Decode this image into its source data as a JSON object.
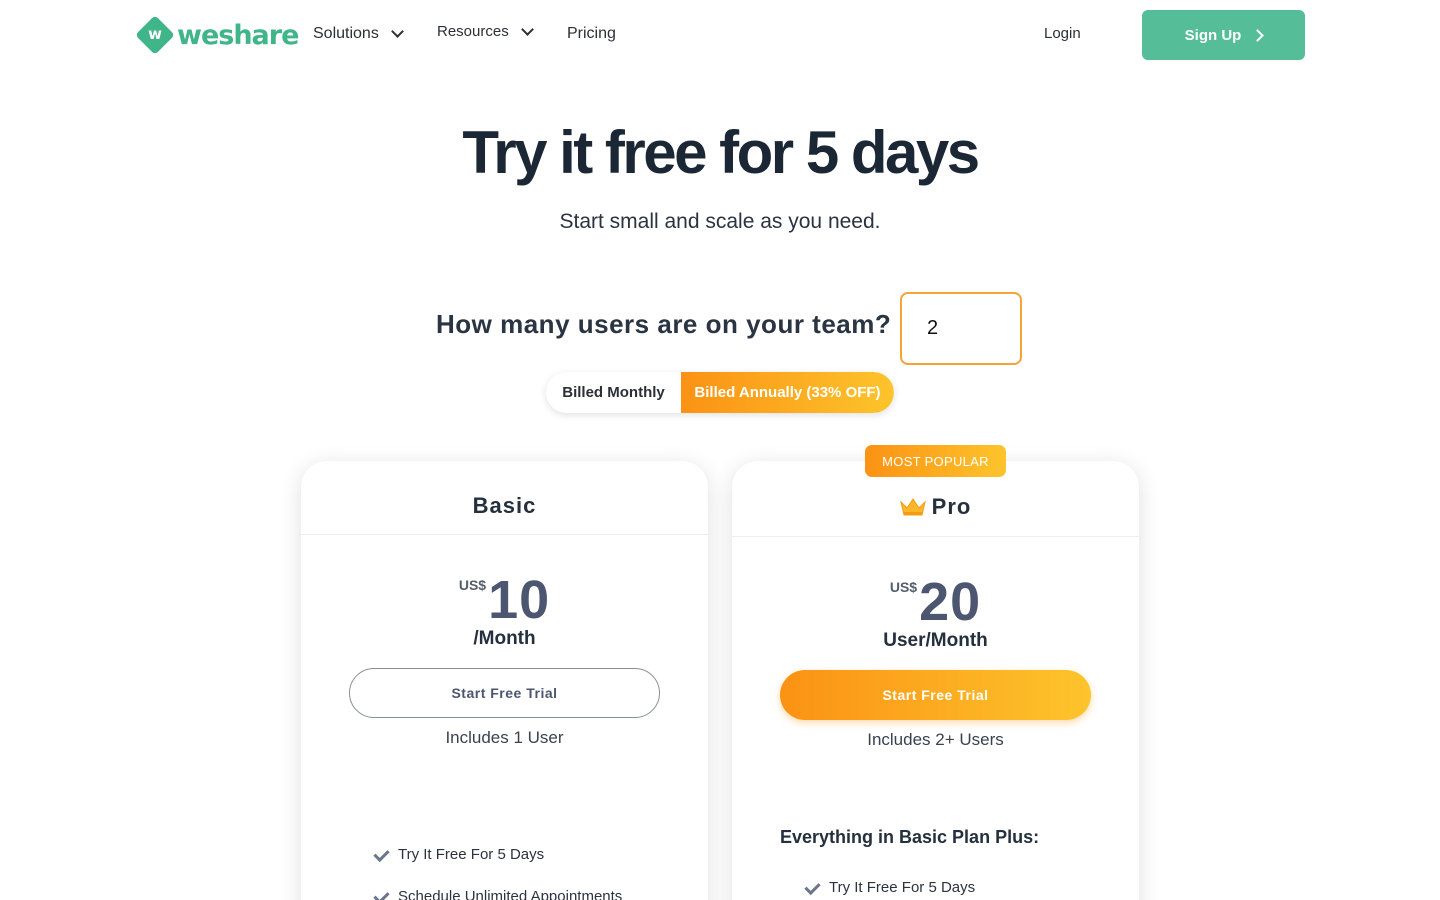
{
  "brand": {
    "name": "weshare",
    "mark_letter": "w",
    "color": "#3fb589"
  },
  "nav": {
    "items": [
      {
        "label": "Solutions",
        "has_dropdown": true
      },
      {
        "label": "Resources",
        "has_dropdown": true
      },
      {
        "label": "Pricing",
        "has_dropdown": false
      }
    ],
    "login": "Login",
    "signup": "Sign Up"
  },
  "hero": {
    "title": "Try it free for 5 days",
    "subtitle": "Start small and scale as you need."
  },
  "team": {
    "question": "How many users are on your team?",
    "value": "2"
  },
  "billing": {
    "monthly": "Billed Monthly",
    "annual": "Billed Annually (33% OFF)",
    "selected": "annual"
  },
  "plans": {
    "basic": {
      "name": "Basic",
      "currency": "US$",
      "amount": "10",
      "period": "/Month",
      "cta": "Start Free Trial",
      "includes": "Includes 1 User",
      "features": [
        "Try It Free For 5 Days",
        "Schedule Unlimited Appointments"
      ]
    },
    "pro": {
      "badge": "MOST POPULAR",
      "name": "Pro",
      "currency": "US$",
      "amount": "20",
      "period": "User/Month",
      "cta": "Start Free Trial",
      "includes": "Includes 2+ Users",
      "plus_heading": "Everything in Basic Plan Plus:",
      "features": [
        "Try It Free For 5 Days"
      ]
    }
  },
  "colors": {
    "accent_orange": "#fb9214",
    "accent_yellow": "#fdc42c",
    "signup_green": "#55bd97"
  }
}
